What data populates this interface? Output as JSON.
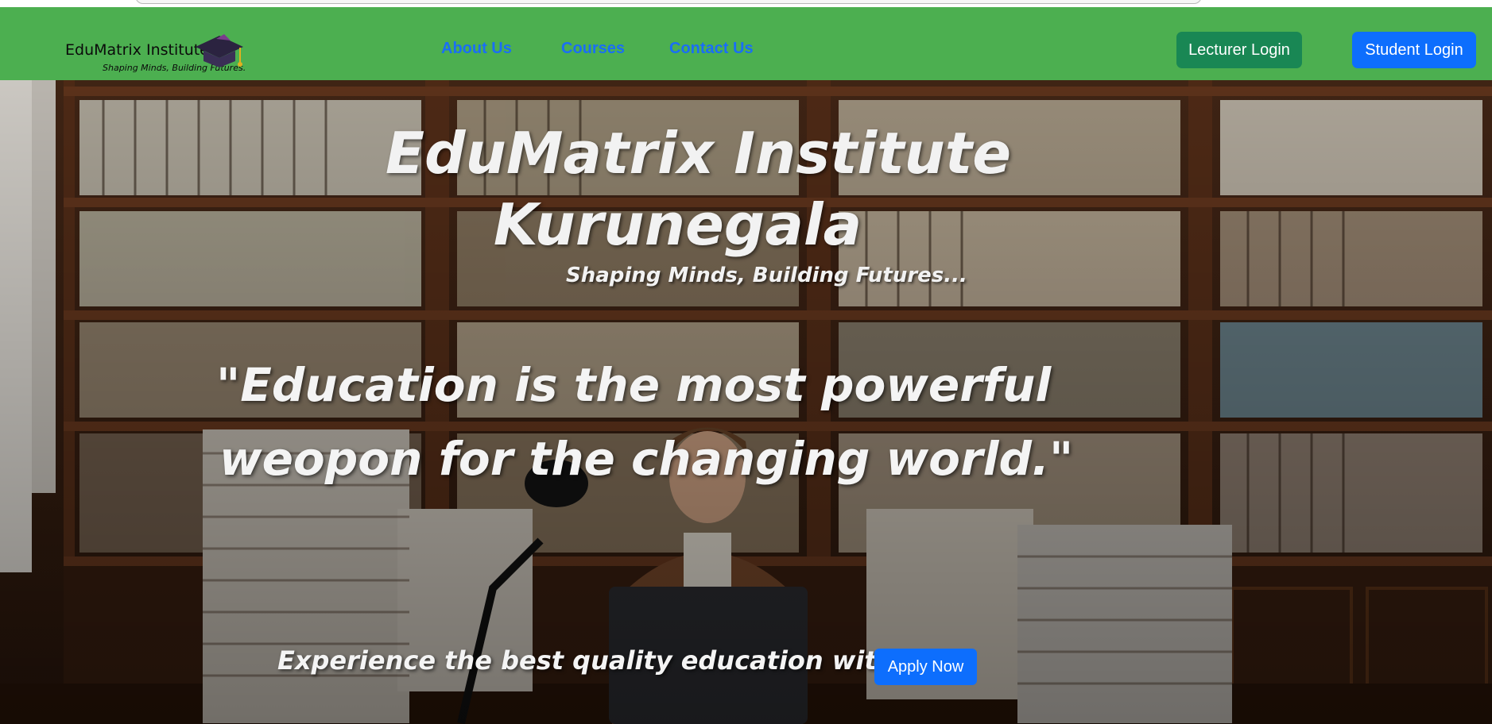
{
  "navbar": {
    "brand_name": "EduMatrix Institute",
    "brand_tagline": "Shaping Minds, Building Futures.",
    "links": [
      {
        "label": "About Us"
      },
      {
        "label": "Courses"
      },
      {
        "label": "Contact Us"
      }
    ],
    "lecturer_login": "Lecturer Login",
    "student_login": "Student Login"
  },
  "hero": {
    "title_line1": "EduMatrix Institute",
    "title_line2": "Kurunegala",
    "tagline": "Shaping Minds, Building Futures...",
    "quote_line1": "\"Education is the most powerful",
    "quote_line2": "weopon for the changing world.\"",
    "cta_text": "Experience the best quality education with us",
    "apply_button": "Apply Now"
  },
  "colors": {
    "navbar_bg": "#4caf50",
    "nav_link": "#1a6ef5",
    "lecturer_button": "#198754",
    "student_button": "#0d6efd",
    "apply_button": "#0d6efd"
  },
  "icons": {
    "brand_logo": "graduation-cap-icon"
  }
}
